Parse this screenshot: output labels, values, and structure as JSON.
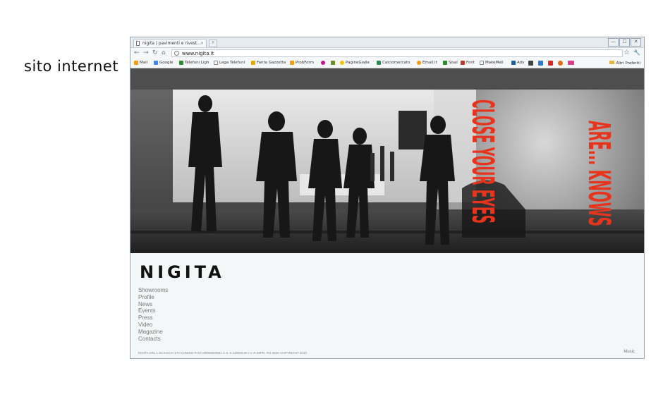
{
  "page": {
    "side_title": "sito internet"
  },
  "browser": {
    "tab_title": "nigita | pavimenti e rivest...",
    "tab_close": "×",
    "url": "www.nigita.it",
    "window_controls": [
      "—",
      "☐",
      "✕"
    ],
    "bookmarks": [
      {
        "label": "Mail",
        "color": "#f39c12"
      },
      {
        "label": "Google",
        "color": "#4285f4"
      },
      {
        "label": "Telefuni Ligh",
        "color": "#2c8c2f"
      },
      {
        "label": "Lega Telefuni",
        "color": "#ffffff"
      },
      {
        "label": "Fanta Gazzetta",
        "color": "#e4a800"
      },
      {
        "label": "ProbForm",
        "color": "#f39c12"
      },
      {
        "label": "PagineGialle",
        "color": "#f5c400"
      },
      {
        "label": "Calciomercato",
        "color": "#2e8b57"
      },
      {
        "label": "Email.it",
        "color": "#f39c12"
      },
      {
        "label": "Sisal",
        "color": "#2c8c2f"
      },
      {
        "label": "Font",
        "color": "#c0392b"
      },
      {
        "label": "MakeMeil",
        "color": "#ffffff"
      },
      {
        "label": "Adv",
        "color": "#1f5fa8"
      }
    ],
    "other_bookmarks": "Altri Preferiti"
  },
  "site": {
    "hero_text_left": "CLOSE YOUR EYES",
    "hero_text_right": "ARE... KNOWS",
    "hero_color": "#e8341c",
    "logo": "NIGITA",
    "menu": [
      "Showrooms",
      "Profile",
      "News",
      "Events",
      "Press",
      "Video",
      "Magazine",
      "Contacts"
    ],
    "company_info": "NIGITA SRL   L.SCIASCIA 170 COMISO   P.IVA 00909920881   C.S. € 119000,00 I.V.   R.IMPR. RG 3630   COPYRIGHT 2010",
    "music": "Music"
  }
}
